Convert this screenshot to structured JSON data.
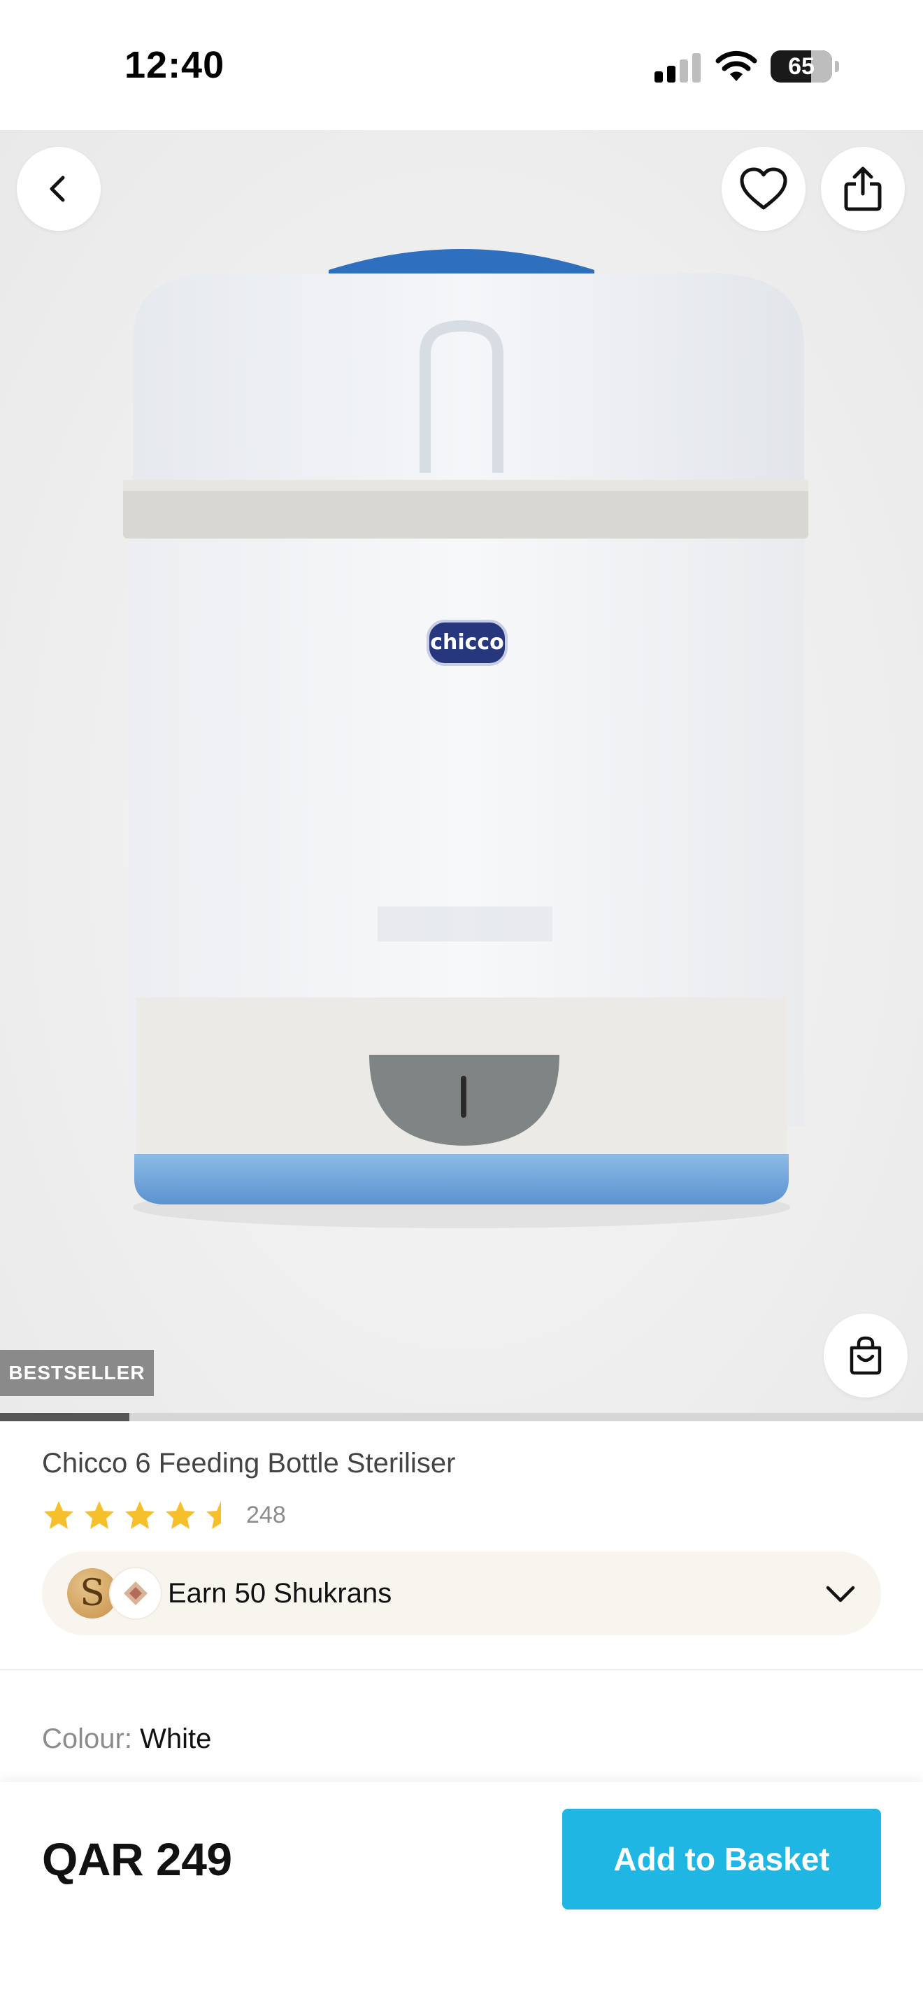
{
  "status_bar": {
    "time": "12:40",
    "battery_level": "65",
    "icons": [
      "signal-icon",
      "wifi-icon",
      "battery-icon"
    ]
  },
  "hero": {
    "badge": "BESTSELLER",
    "image_brand_label": "chicco",
    "gallery_progress": 0.14,
    "icons": [
      "back-chevron-icon",
      "heart-icon",
      "share-icon",
      "shopping-bag-icon"
    ]
  },
  "product": {
    "title": "Chicco 6 Feeding Bottle Steriliser",
    "rating": 4.5,
    "rating_count": "248",
    "star_color": "#f6c02d"
  },
  "rewards": {
    "text": "Earn 50 Shukrans",
    "coin_letter": "S",
    "icons": [
      "shukran-coin-icon",
      "diamond-icon",
      "chevron-down-icon"
    ]
  },
  "colour": {
    "label": "Colour:",
    "value": "White"
  },
  "bottom_bar": {
    "price": "QAR 249",
    "button_label": "Add to Basket",
    "button_color": "#1fb6e3"
  }
}
